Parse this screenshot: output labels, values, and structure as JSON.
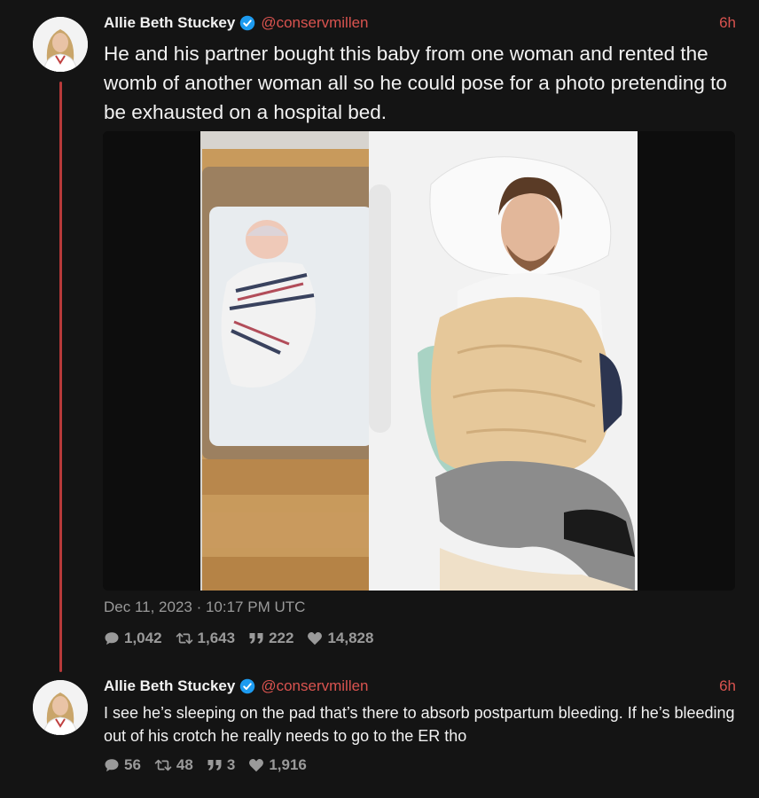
{
  "tweet": {
    "author_name": "Allie Beth Stuckey",
    "handle": "@conservmillen",
    "time": "6h",
    "text": "He and his partner bought this baby from one woman and rented the womb of another woman all so he could pose for a photo pretending to be exhausted on a hospital bed.",
    "date": "Dec 11, 2023 · 10:17 PM UTC",
    "stats": {
      "replies": "1,042",
      "retweets": "1,643",
      "quotes": "222",
      "likes": "14,828"
    }
  },
  "reply": {
    "author_name": "Allie Beth Stuckey",
    "handle": "@conservmillen",
    "time": "6h",
    "text": "I see he’s sleeping on the pad that’s there to absorb postpartum bleeding. If he’s bleeding out of his crotch he really needs to go to the ER tho",
    "stats": {
      "replies": "56",
      "retweets": "48",
      "quotes": "3",
      "likes": "1,916"
    }
  },
  "colors": {
    "background": "#141414",
    "accent": "#d9534f",
    "thread_line": "#b83a3a",
    "verified": "#1d9bf0",
    "muted": "#9a9a9a"
  },
  "icons": [
    "verified-badge-icon",
    "reply-icon",
    "retweet-icon",
    "quote-icon",
    "heart-icon"
  ]
}
